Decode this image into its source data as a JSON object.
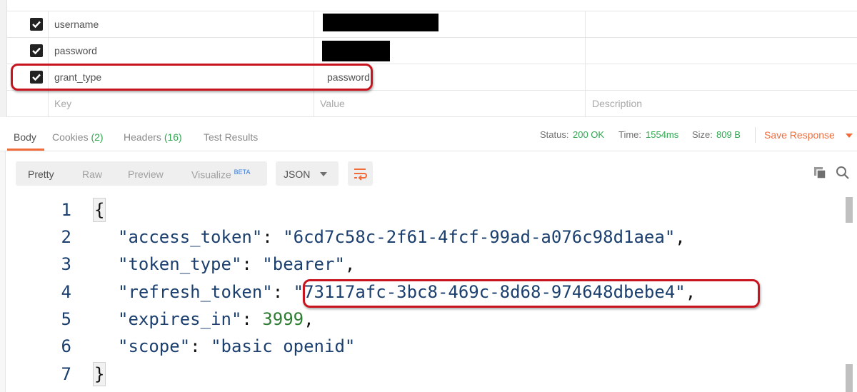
{
  "params": {
    "rows": [
      {
        "key": "username",
        "value": ""
      },
      {
        "key": "password",
        "value": ""
      },
      {
        "key": "grant_type",
        "value": "password"
      }
    ],
    "placeholder": {
      "key": "Key",
      "value": "Value",
      "description": "Description"
    }
  },
  "response_tabs": {
    "body": "Body",
    "cookies": "Cookies",
    "cookies_count": "(2)",
    "headers": "Headers",
    "headers_count": "(16)",
    "test_results": "Test Results"
  },
  "status": {
    "status_label": "Status:",
    "status_value": "200 OK",
    "time_label": "Time:",
    "time_value": "1554ms",
    "size_label": "Size:",
    "size_value": "809 B",
    "save_response": "Save Response"
  },
  "format": {
    "pretty": "Pretty",
    "raw": "Raw",
    "preview": "Preview",
    "visualize": "Visualize",
    "beta": "BETA",
    "language": "JSON"
  },
  "code": {
    "line_numbers": [
      "1",
      "2",
      "3",
      "4",
      "5",
      "6",
      "7"
    ],
    "open_brace": "{",
    "close_brace": "}",
    "k_access_token": "\"access_token\"",
    "v_access_token": "\"6cd7c58c-2f61-4fcf-99ad-a076c98d1aea\"",
    "k_token_type": "\"token_type\"",
    "v_token_type": "\"bearer\"",
    "k_refresh_token": "\"refresh_token\"",
    "v_refresh_token": "\"73117afc-3bc8-469c-8d68-974648dbebe4\"",
    "k_expires_in": "\"expires_in\"",
    "v_expires_in": "3999",
    "k_scope": "\"scope\"",
    "v_scope": "\"basic openid\""
  },
  "colors": {
    "accent_orange": "#f26b3a",
    "success_green": "#2fa84f",
    "highlight_red": "#c8141e",
    "json_blue": "#1b3f6e"
  }
}
